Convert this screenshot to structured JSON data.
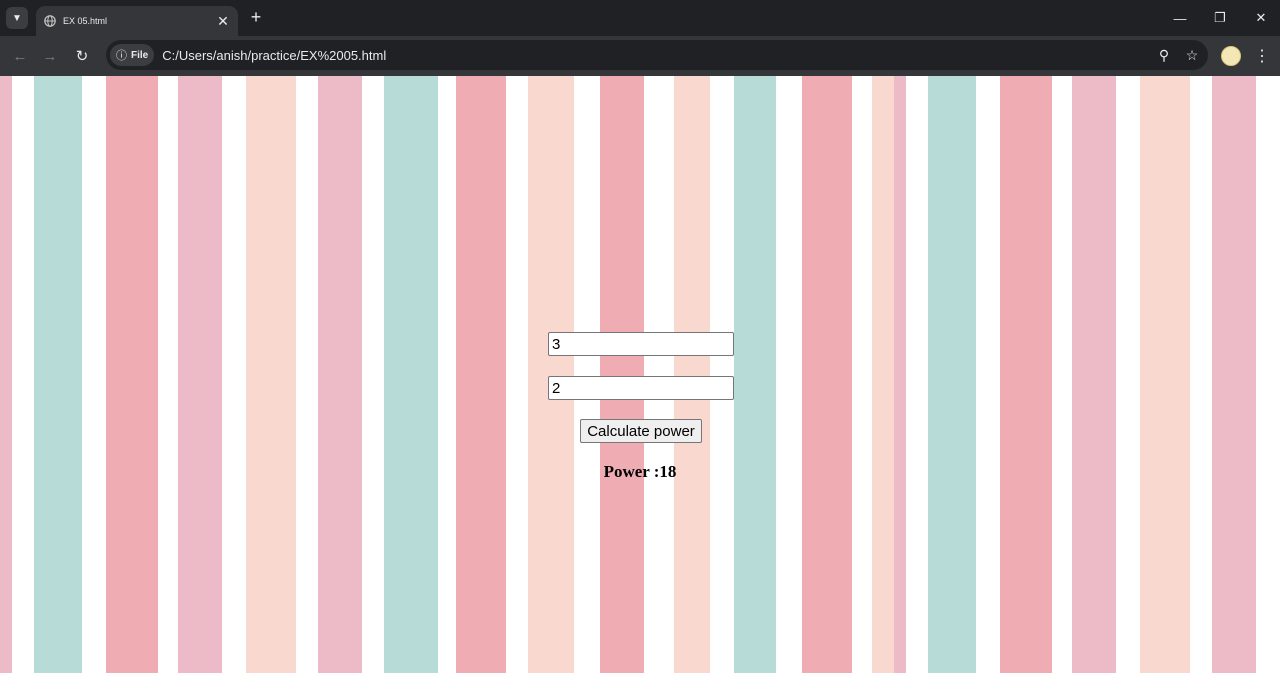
{
  "browser": {
    "tab_title": "EX 05.html",
    "new_tab_label": "+",
    "url_chip_label": "File",
    "url": "C:/Users/anish/practice/EX%2005.html",
    "icons": [
      "chevron-down-icon",
      "globe-icon",
      "close-icon",
      "plus-icon",
      "minimize-icon",
      "restore-icon",
      "window-close-icon",
      "back-icon",
      "forward-icon",
      "reload-icon",
      "info-icon",
      "zoom-icon",
      "star-icon",
      "profile-avatar",
      "kebab-menu-icon"
    ]
  },
  "page": {
    "inputs": [
      {
        "value": "3"
      },
      {
        "value": "2"
      }
    ],
    "button_label": "Calculate power",
    "result_text": "Power :18"
  },
  "colors": {
    "stripe_teal": "#9fd0c9",
    "stripe_pink": "#e7a3b4",
    "stripe_peach": "#f5cbbf",
    "stripe_rose": "#e9909a"
  }
}
